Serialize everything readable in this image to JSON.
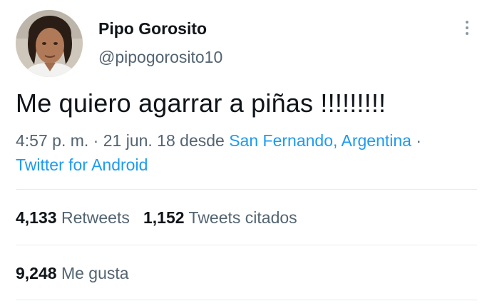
{
  "author": {
    "name": "Pipo Gorosito",
    "handle": "@pipogorosito10"
  },
  "tweet": {
    "text": "Me quiero agarrar a piñas !!!!!!!!!"
  },
  "meta": {
    "time": "4:57 p. m.",
    "sep1": " · ",
    "date": "21 jun. 18",
    "from_word": " desde ",
    "location": "San Fernando, Argentina",
    "sep2": " ·",
    "source": "Twitter for Android"
  },
  "stats": {
    "retweets_count": "4,133",
    "retweets_label": "Retweets",
    "quotes_count": "1,152",
    "quotes_label": "Tweets citados",
    "likes_count": "9,248",
    "likes_label": "Me gusta"
  },
  "icons": {
    "more": "more-vertical-icon"
  },
  "colors": {
    "link": "#1d9bf0",
    "muted": "#536471",
    "text": "#0f1419",
    "divider": "#e6ecf0"
  }
}
